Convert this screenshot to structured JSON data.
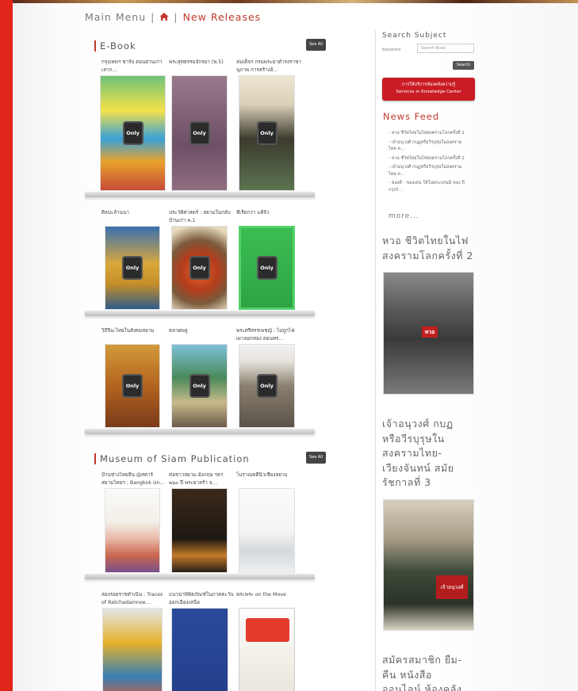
{
  "breadcrumb": {
    "main_menu": "Main Menu",
    "sep1": "|",
    "sep2": "|",
    "current": "New Releases"
  },
  "ebook": {
    "title": "E-Book",
    "see_all": "See All",
    "items": [
      {
        "title": "กรุงเทพฯ ชาร์จ ตอนย่านเก่าเล่าก…"
      },
      {
        "title": "พระสุทธรรมจักรยา (พ.5)"
      },
      {
        "title": "สมเด็จฯ กรมพระยาดำรงราชานุภาพ การสร้างอ้…"
      },
      {
        "title": "ศิลปะล้านนา"
      },
      {
        "title": "ประวัติศาสตร์ : สยามในกลับบ้านเก่า พ.1"
      },
      {
        "title": "ที่เรียกว่า แต้จิ๋ว"
      },
      {
        "title": "วิถีจีน-ไทยในสังคมสยาม"
      },
      {
        "title": "ตลาดพลู"
      },
      {
        "title": "พระศรีสรรเพชญ์ : ไม่ถูกไฟเผาลอกทอง ตอนทร…"
      }
    ],
    "only_label": "Only"
  },
  "musiam": {
    "title": "Museum of Siam Publication",
    "see_all": "See All",
    "items": [
      {
        "title": "บ้านช่างไทยสิ่น @สตาร์ สยามไทยฯ : Bangkok Un…"
      },
      {
        "title": "ต่อชาวสยาม-อังกฤษ ฯลฯ ๒๖๐ ปี พระยาสร้า จ…"
      },
      {
        "title": "โบราณคดีนิวเชียงสยาม"
      },
      {
        "title": "ล่องรอยราชดำเนิน : Traces of Ratchadamnoe…"
      },
      {
        "title": "แนวน่าพิพิธภัณฑ์ในภาคตะวันออกเฉียงเหนือ"
      },
      {
        "title": "พระพระ on the Move"
      }
    ]
  },
  "sidebar": {
    "search_title": "Search Subject",
    "keyword_label": "Keyword",
    "keyword_placeholder": "Search Book",
    "search_button": "Search",
    "kc_line1": "การให้บริการห้องคลังความรู้",
    "kc_line2": "Services in Knowledge Center",
    "news_title": "News Feed",
    "news": [
      "- หวอ ชีวิตไทยในไฟสงครามโลกครั้งที่ 2",
      "- เจ้าอนุวงศ์ กบฏหรือวีรบุรุษในสงครามไทย-ล…",
      "- หวอ ชีวิตไทยในไฟสงครามโลกครั้งที่ 2",
      "- เจ้าอนุวงศ์ กบฏหรือวีรบุรุษในสงครามไทย-ล…",
      "- ของดี - ของเด่น ให้ในพระบรมมิ ของ ปี กรุงรั…"
    ],
    "more": "more...",
    "feat1": "หวอ ชีวิตไทยในไฟสงครามโลกครั้งที่ 2",
    "feat2": "เจ้าอนุวงศ์ กบฏหรือวีรบุรุษในสงครามไทย-เวียงจันทน์ สมัยรัชกาลที่ 3",
    "feat2_cover": "เจ้าอนุวงศ์",
    "feat1_cover": "หวอ",
    "feat3": "สมัครสมาชิก ยืม-คืน หนังสือ ออนไลน์ ห้องคลัง"
  },
  "colors": {
    "brand_red": "#e1251b",
    "accent": "#c0392b"
  }
}
